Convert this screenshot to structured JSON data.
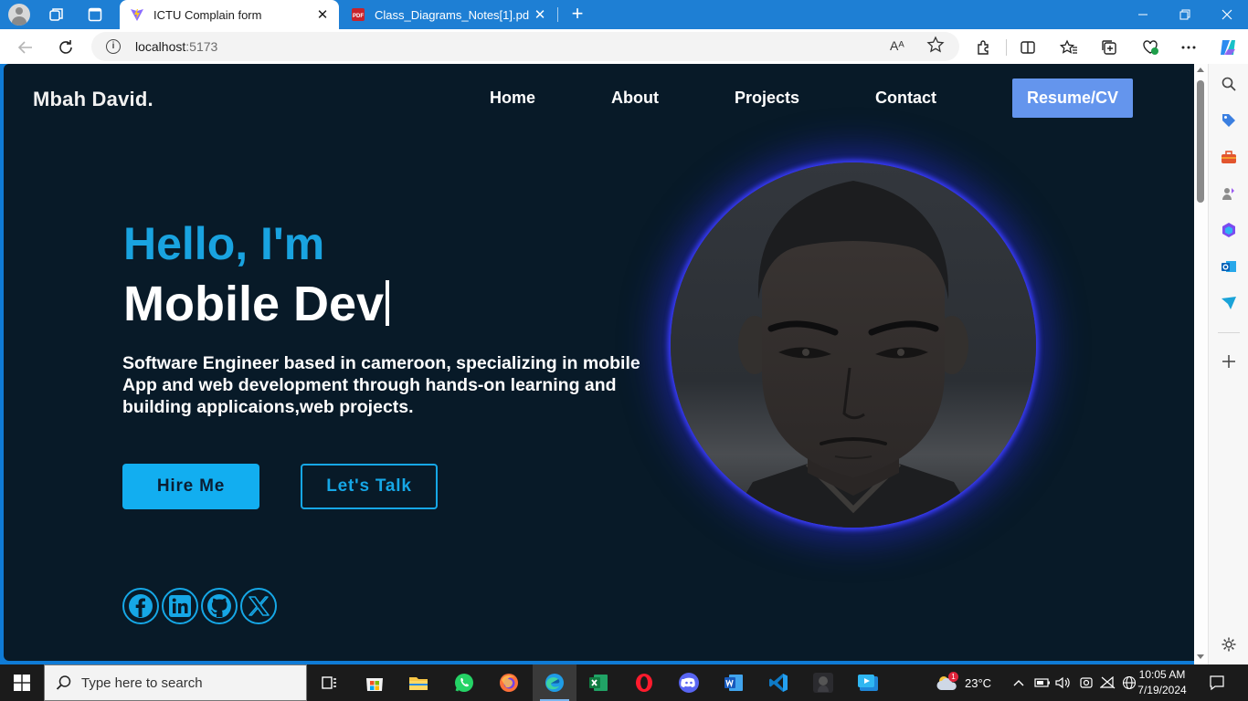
{
  "browser": {
    "tabs": [
      {
        "label": "ICTU Complain form",
        "icon": "vite-icon",
        "active": true
      },
      {
        "label": "Class_Diagrams_Notes[1].pdf",
        "icon": "pdf-icon",
        "active": false
      }
    ],
    "address": {
      "host": "localhost",
      "port": ":5173"
    },
    "read_aloud_label": "Aᴬ"
  },
  "page": {
    "logo": "Mbah David.",
    "nav": [
      {
        "label": "Home"
      },
      {
        "label": "About"
      },
      {
        "label": "Projects"
      },
      {
        "label": "Contact"
      }
    ],
    "resume_button": "Resume/CV",
    "greeting": "Hello, I'm",
    "role": "Mobile Dev",
    "bio": "Software Engineer based in cameroon, specializing in mobile App and web development through hands-on learning and building applicaions,web projects.",
    "hire_button": "Hire Me",
    "talk_button": "Let's Talk",
    "socials": [
      "facebook-icon",
      "linkedin-icon",
      "github-icon",
      "x-icon"
    ],
    "colors": {
      "background": "#081a28",
      "accent": "#16a7e6",
      "resume": "#6495ed",
      "glow": "#3b3dff"
    }
  },
  "taskbar": {
    "search_placeholder": "Type here to search",
    "weather": {
      "temp": "23°C",
      "badge": "1"
    },
    "time": "10:05 AM",
    "date": "7/19/2024"
  }
}
